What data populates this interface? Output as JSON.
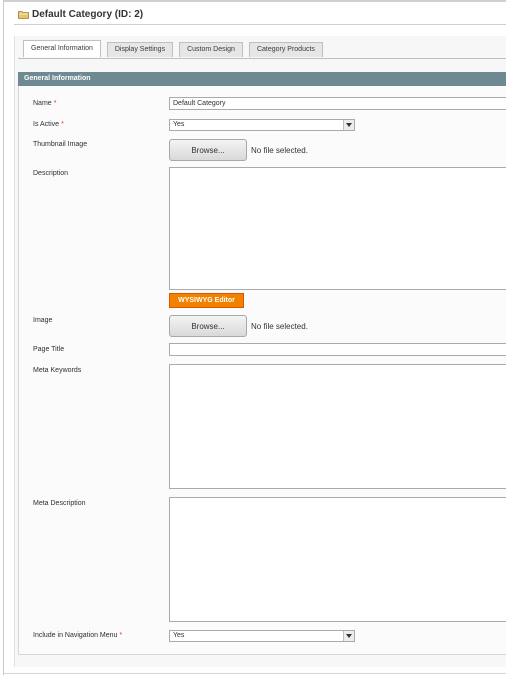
{
  "page": {
    "title": "Default Category (ID: 2)",
    "title_icon": "folder-icon"
  },
  "tabs": [
    {
      "label": "General Information",
      "active": true
    },
    {
      "label": "Display Settings",
      "active": false
    },
    {
      "label": "Custom Design",
      "active": false
    },
    {
      "label": "Category Products",
      "active": false
    }
  ],
  "section": {
    "header": "General Information"
  },
  "fields": {
    "name": {
      "label": "Name",
      "required": "*",
      "value": "Default Category"
    },
    "is_active": {
      "label": "Is Active",
      "required": "*",
      "value": "Yes"
    },
    "thumbnail": {
      "label": "Thumbnail Image",
      "button": "Browse...",
      "status": "No file selected."
    },
    "description": {
      "label": "Description",
      "value": "",
      "editor_button": "WYSIWYG Editor"
    },
    "image": {
      "label": "Image",
      "button": "Browse...",
      "status": "No file selected."
    },
    "page_title": {
      "label": "Page Title",
      "value": ""
    },
    "meta_keywords": {
      "label": "Meta Keywords",
      "value": ""
    },
    "meta_description": {
      "label": "Meta Description",
      "value": ""
    },
    "include_in_menu": {
      "label": "Include in Navigation Menu",
      "required": "*",
      "value": "Yes"
    }
  },
  "colors": {
    "section_header": "#6f8992",
    "required_star": "#eb340a",
    "wysiwyg_button": "#f18200"
  }
}
